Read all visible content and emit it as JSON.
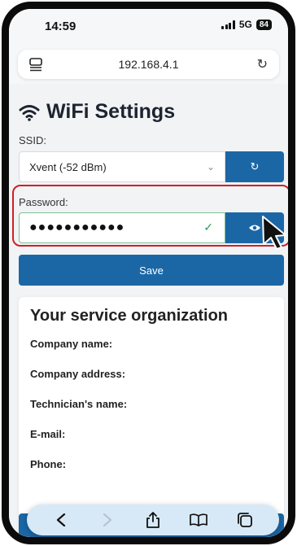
{
  "status": {
    "time": "14:59",
    "network": "5G",
    "battery": "84"
  },
  "browser": {
    "url": "192.168.4.1"
  },
  "page": {
    "title": "WiFi Settings",
    "ssid_label": "SSID:",
    "ssid_value": "Xvent (-52 dBm)",
    "password_label": "Password:",
    "password_value": "●●●●●●●●●●●",
    "save_label": "Save"
  },
  "service_card": {
    "title": "Your service organization",
    "fields": [
      "Company name:",
      "Company address:",
      "Technician's name:",
      "E-mail:",
      "Phone:"
    ]
  },
  "colors": {
    "accent": "#1b67a6",
    "highlight": "#d11f26",
    "check": "#2a9d58"
  },
  "icons": {
    "reader": "reader-mode-icon",
    "reload": "reload-icon",
    "wifi": "wifi-icon",
    "refresh": "refresh-icon",
    "eye": "eye-icon",
    "back": "back-icon",
    "forward": "forward-icon",
    "share": "share-icon",
    "bookmarks": "bookmarks-icon",
    "tabs": "tabs-icon"
  }
}
